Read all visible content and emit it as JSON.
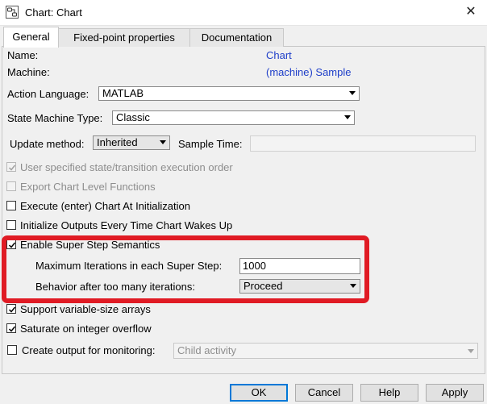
{
  "window": {
    "title": "Chart: Chart",
    "close_glyph": "✕"
  },
  "tabs": [
    {
      "label": "General",
      "active": true
    },
    {
      "label": "Fixed-point properties",
      "active": false
    },
    {
      "label": "Documentation",
      "active": false
    }
  ],
  "fields": {
    "name_label": "Name:",
    "name_value": "Chart",
    "machine_label": "Machine:",
    "machine_value": "(machine) Sample",
    "action_language_label": "Action Language:",
    "action_language_value": "MATLAB",
    "state_machine_type_label": "State Machine Type:",
    "state_machine_type_value": "Classic",
    "update_method_label": "Update method:",
    "update_method_value": "Inherited",
    "sample_time_label": "Sample Time:",
    "sample_time_value": ""
  },
  "checkboxes": {
    "user_specified_order": {
      "label": "User specified state/transition execution order",
      "checked": true,
      "enabled": false
    },
    "export_chart_level_functions": {
      "label": "Export Chart Level Functions",
      "checked": false,
      "enabled": false
    },
    "execute_at_init": {
      "label": "Execute (enter) Chart At Initialization",
      "checked": false,
      "enabled": true
    },
    "initialize_outputs": {
      "label": "Initialize Outputs Every Time Chart Wakes Up",
      "checked": false,
      "enabled": true
    },
    "enable_super_step": {
      "label": "Enable Super Step Semantics",
      "checked": true,
      "enabled": true
    },
    "support_variable_size": {
      "label": "Support variable-size arrays",
      "checked": true,
      "enabled": true
    },
    "saturate_overflow": {
      "label": "Saturate on integer overflow",
      "checked": true,
      "enabled": true
    },
    "create_output_monitoring": {
      "label": "Create output for monitoring:",
      "checked": false,
      "enabled": true
    }
  },
  "super_step": {
    "max_iterations_label": "Maximum Iterations in each Super Step:",
    "max_iterations_value": "1000",
    "behavior_label": "Behavior after too many iterations:",
    "behavior_value": "Proceed"
  },
  "monitoring": {
    "value": "Child activity"
  },
  "buttons": {
    "ok": "OK",
    "cancel": "Cancel",
    "help": "Help",
    "apply": "Apply"
  },
  "colors": {
    "highlight": "#e01b24",
    "link": "#1f3fc9"
  }
}
